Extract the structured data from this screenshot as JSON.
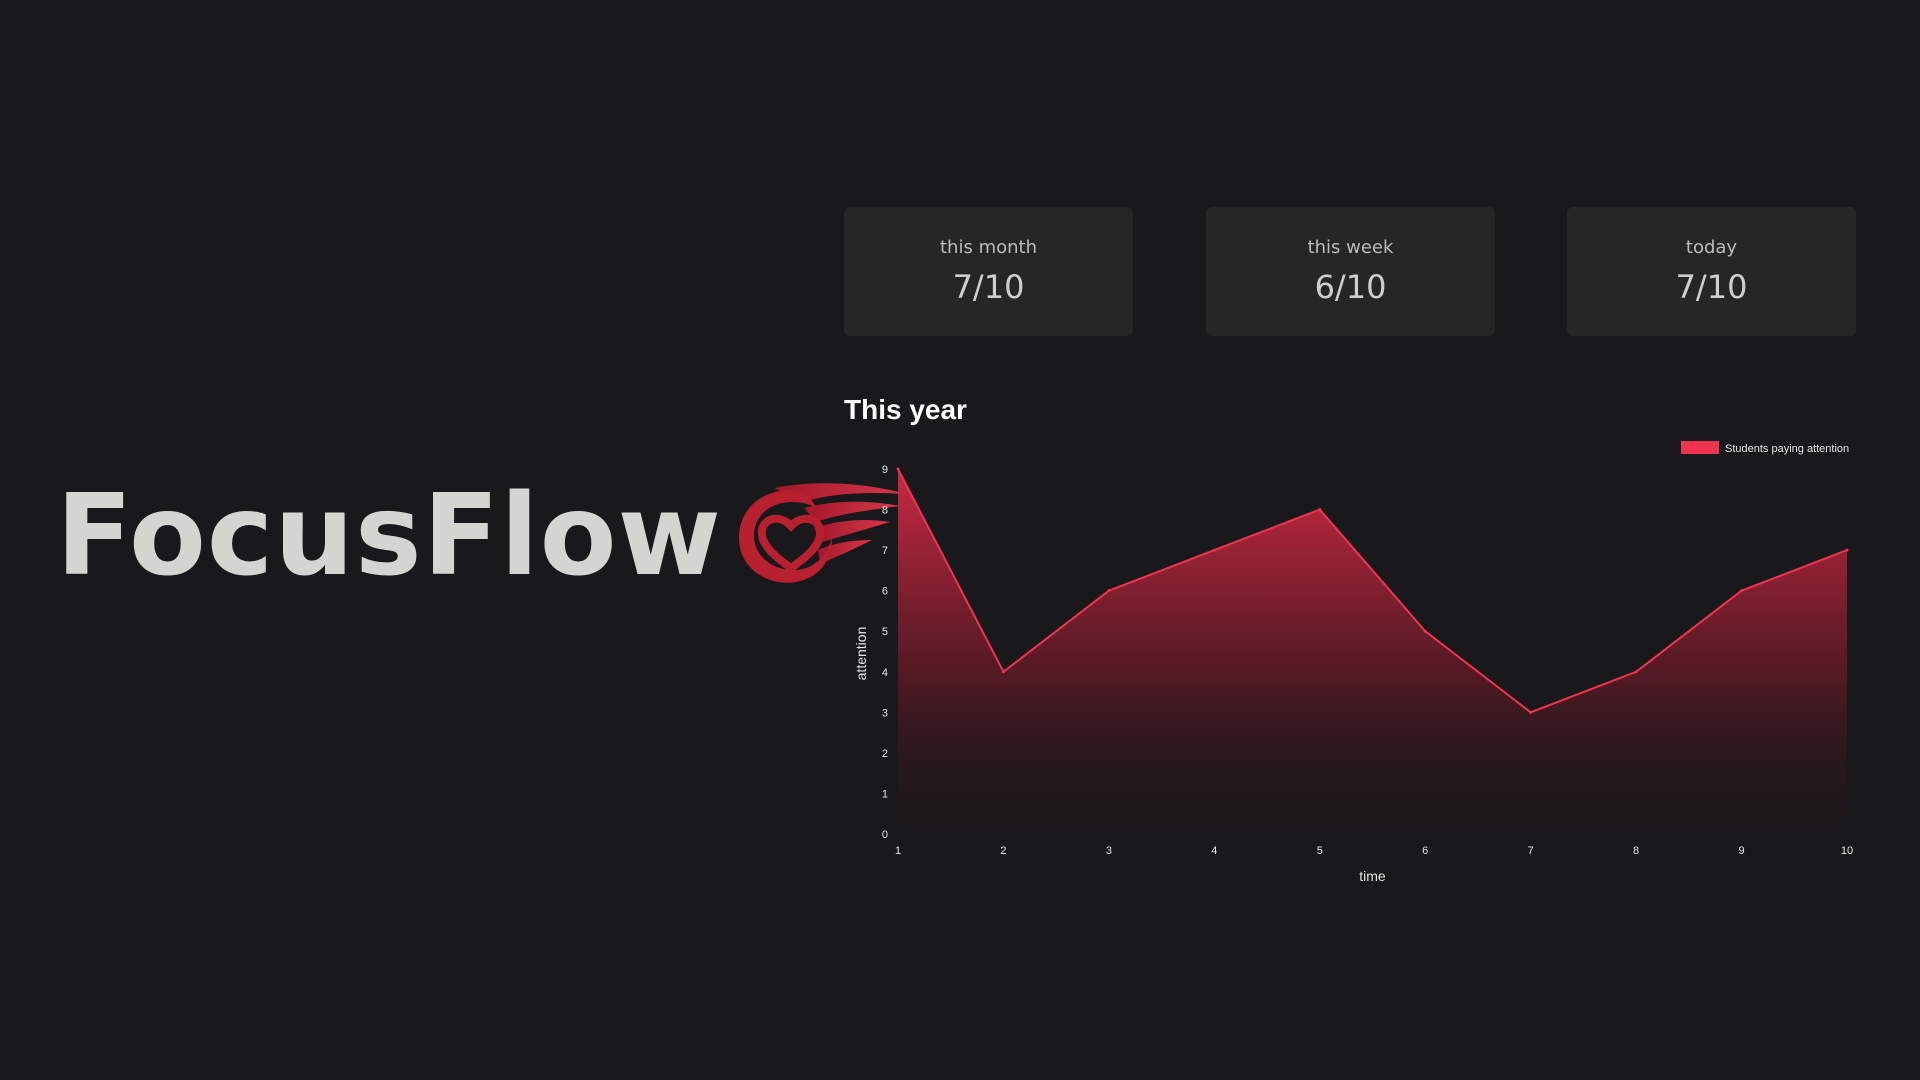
{
  "brand": {
    "name": "FocusFlow",
    "logo_icon": "winged-heart-icon",
    "accent": "#c0283d"
  },
  "stats": [
    {
      "label": "this month",
      "value": "7/10"
    },
    {
      "label": "this week",
      "value": "6/10"
    },
    {
      "label": "today",
      "value": "7/10"
    }
  ],
  "chart": {
    "title": "This year"
  },
  "chart_data": {
    "type": "area",
    "title": "This year",
    "xlabel": "time",
    "ylabel": "attention",
    "x": [
      1,
      2,
      3,
      4,
      5,
      6,
      7,
      8,
      9,
      10
    ],
    "series": [
      {
        "name": "Students paying attention",
        "values": [
          9,
          4,
          6,
          7,
          8,
          5,
          3,
          4,
          6,
          7
        ],
        "color": "#f0334f"
      }
    ],
    "xlim": [
      1,
      10
    ],
    "ylim": [
      0,
      9
    ],
    "yticks": [
      0,
      1,
      2,
      3,
      4,
      5,
      6,
      7,
      8,
      9
    ],
    "xticks": [
      1,
      2,
      3,
      4,
      5,
      6,
      7,
      8,
      9,
      10
    ],
    "grid": false,
    "legend_position": "top-right"
  }
}
